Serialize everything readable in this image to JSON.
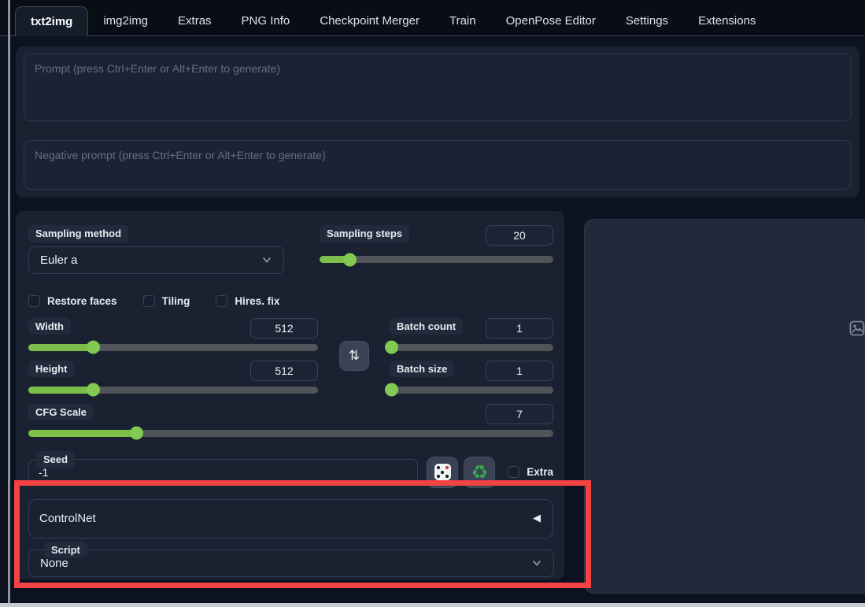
{
  "tabs": [
    {
      "label": "txt2img",
      "active": true
    },
    {
      "label": "img2img",
      "active": false
    },
    {
      "label": "Extras",
      "active": false
    },
    {
      "label": "PNG Info",
      "active": false
    },
    {
      "label": "Checkpoint Merger",
      "active": false
    },
    {
      "label": "Train",
      "active": false
    },
    {
      "label": "OpenPose Editor",
      "active": false
    },
    {
      "label": "Settings",
      "active": false
    },
    {
      "label": "Extensions",
      "active": false
    }
  ],
  "prompt": {
    "placeholder": "Prompt (press Ctrl+Enter or Alt+Enter to generate)",
    "negative_placeholder": "Negative prompt (press Ctrl+Enter or Alt+Enter to generate)"
  },
  "sampling": {
    "method_label": "Sampling method",
    "method_value": "Euler a",
    "steps_label": "Sampling steps",
    "steps_value": "20",
    "steps_percent": 13
  },
  "toggles": {
    "restore_faces": "Restore faces",
    "tiling": "Tiling",
    "hires_fix": "Hires. fix"
  },
  "dimensions": {
    "width_label": "Width",
    "width_value": "512",
    "width_percent": 22.6,
    "height_label": "Height",
    "height_value": "512",
    "height_percent": 22.6
  },
  "batch": {
    "count_label": "Batch count",
    "count_value": "1",
    "count_percent": 1,
    "size_label": "Batch size",
    "size_value": "1",
    "size_percent": 1
  },
  "cfg": {
    "label": "CFG Scale",
    "value": "7",
    "percent": 20.7
  },
  "seed": {
    "label": "Seed",
    "value": "-1",
    "extra_label": "Extra"
  },
  "controlnet": {
    "title": "ControlNet",
    "collapse_arrow": "◀"
  },
  "script": {
    "label": "Script",
    "value": "None"
  },
  "icons": {
    "swap": "swap-dimensions-arrows",
    "dice": "random-seed-dice",
    "recycle": "reuse-seed-recycle",
    "recycle_glyph": "♻",
    "swap_glyph": "⇅",
    "image_placeholder": "output-image-placeholder"
  },
  "colors": {
    "accent_green": "#7bbf4a",
    "slider_track": "#515459",
    "highlight_red": "#f54242",
    "card_bg": "#1a2231",
    "page_bg": "#0d1220"
  }
}
